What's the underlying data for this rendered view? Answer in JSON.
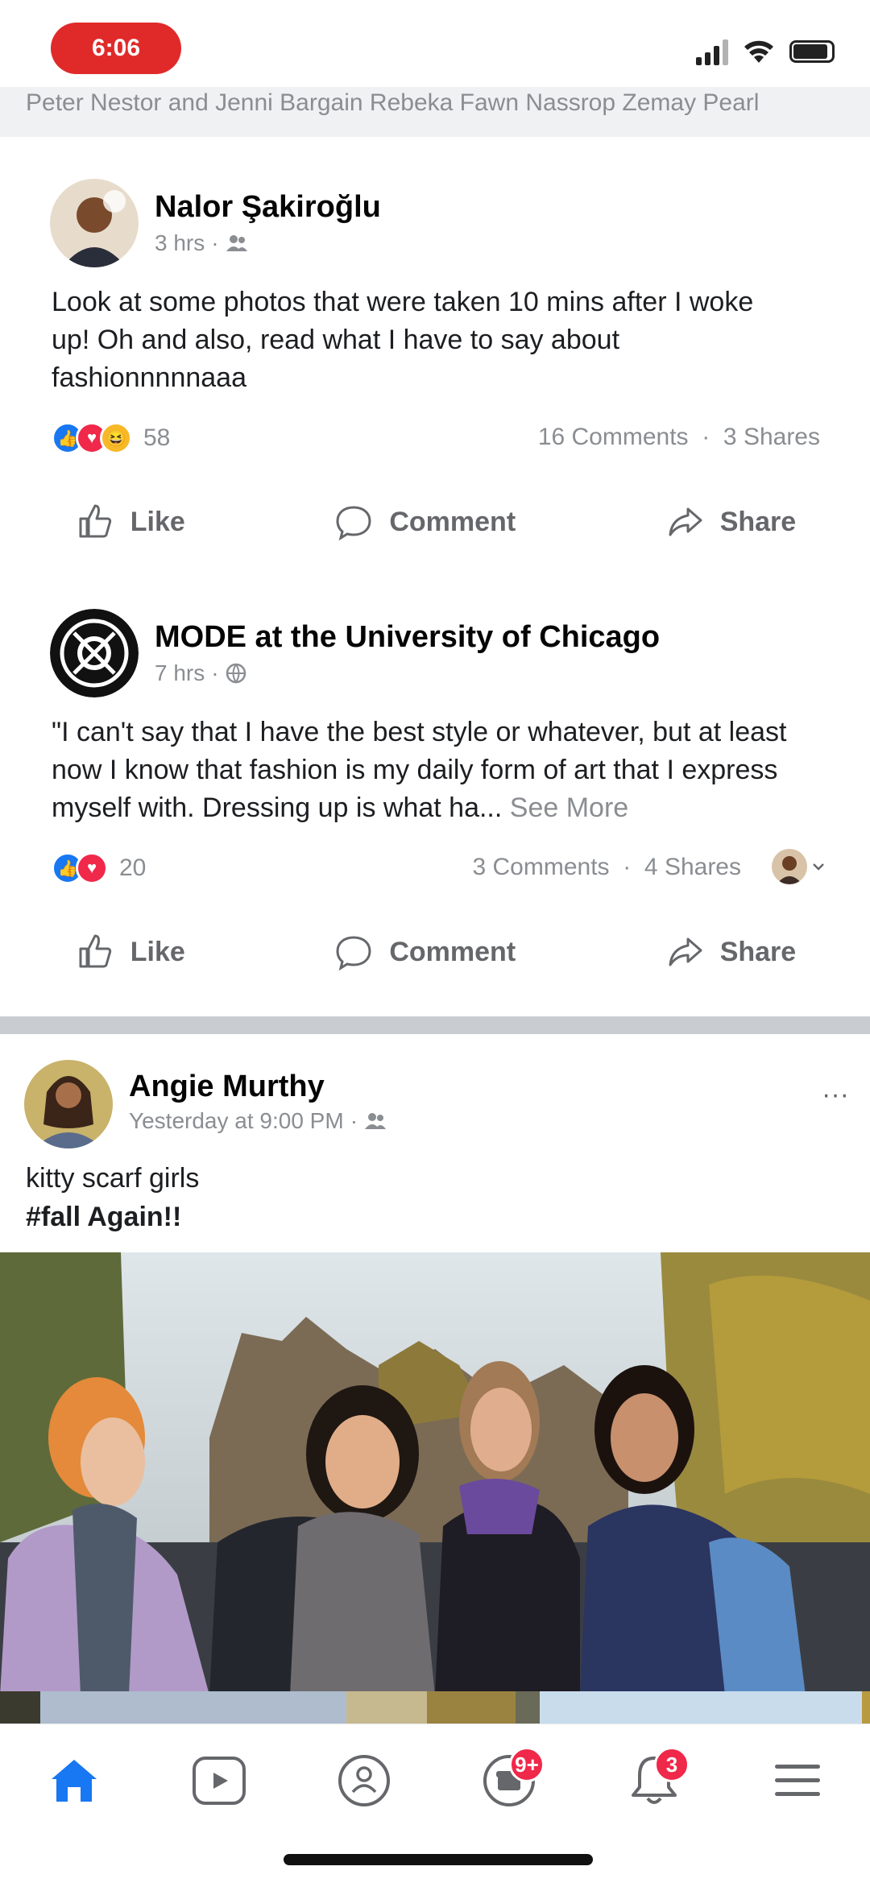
{
  "status_bar": {
    "time": "6:06"
  },
  "shared_strip": {
    "text": "Peter Nestor and Jenni Bargain Rebeka Fawn Nassrop Zemay Pearl"
  },
  "posts": [
    {
      "author": "Nalor Şakiroğlu",
      "time": "3 hrs",
      "audience_icon": "friends-icon",
      "text": "Look at some photos that were taken 10 mins after I woke up! Oh and also, read what I have to say about fashionnnnnaaa",
      "reaction_count": "58",
      "comments": "16 Comments",
      "shares": "3 Shares"
    },
    {
      "author": "MODE at the University of Chicago",
      "time": "7 hrs",
      "audience_icon": "globe-icon",
      "text": "\"I can't say that I have the best style or whatever, but at least now I know that fashion is my daily form of art that I express myself with. Dressing up is what ha...",
      "see_more": "See More",
      "reaction_count": "20",
      "comments": "3 Comments",
      "shares": "4 Shares"
    },
    {
      "author": "Angie Murthy",
      "time": "Yesterday at 9:00 PM",
      "audience_icon": "friends-icon",
      "text_line1": "kitty scarf girls",
      "text_line2": "#fall Again!!",
      "more": "···"
    }
  ],
  "actions": {
    "like": "Like",
    "comment": "Comment",
    "share": "Share"
  },
  "tabbar": {
    "items": [
      {
        "name": "home",
        "active": true
      },
      {
        "name": "watch"
      },
      {
        "name": "groups"
      },
      {
        "name": "marketplace",
        "badge": "9+"
      },
      {
        "name": "notifications",
        "badge": "3"
      },
      {
        "name": "menu"
      }
    ]
  },
  "colors": {
    "accent": "#1877f2",
    "badge": "#f02849",
    "status_pill": "#e02a2a"
  }
}
